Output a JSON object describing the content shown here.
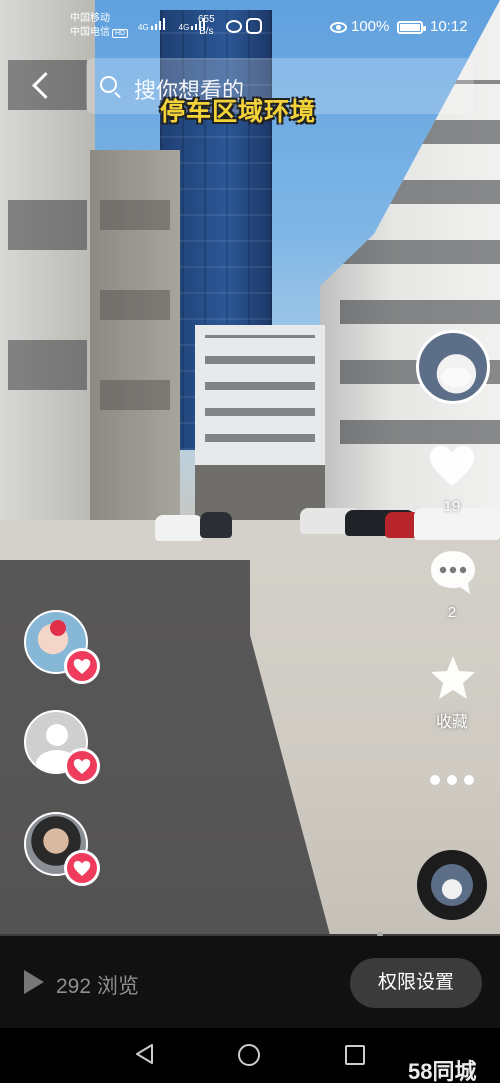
{
  "status_bar": {
    "carrier_1": "中国移动",
    "carrier_2": "中国电信",
    "hd_badge": "HD",
    "network_1": "4G",
    "network_2": "4G",
    "net_speed_value": "655",
    "net_speed_unit": "B/s",
    "battery": "100%",
    "time": "10:12"
  },
  "search": {
    "placeholder": "搜你想看的"
  },
  "video": {
    "caption": "停车区域环境"
  },
  "actions": {
    "like_count": "19",
    "comment_count": "2",
    "collect_label": "收藏"
  },
  "footer": {
    "view_count": "292 浏览",
    "permission_button": "权限设置"
  },
  "watermark": "58同城",
  "progress": {
    "fraction": 0.76
  },
  "colors": {
    "heart_badge": "#f03c5c",
    "caption": "#f4d338"
  },
  "icons": [
    "back-arrow",
    "search",
    "heart",
    "comment",
    "star",
    "more-dots",
    "music-disc",
    "play",
    "nav-back",
    "nav-home",
    "nav-recent"
  ]
}
